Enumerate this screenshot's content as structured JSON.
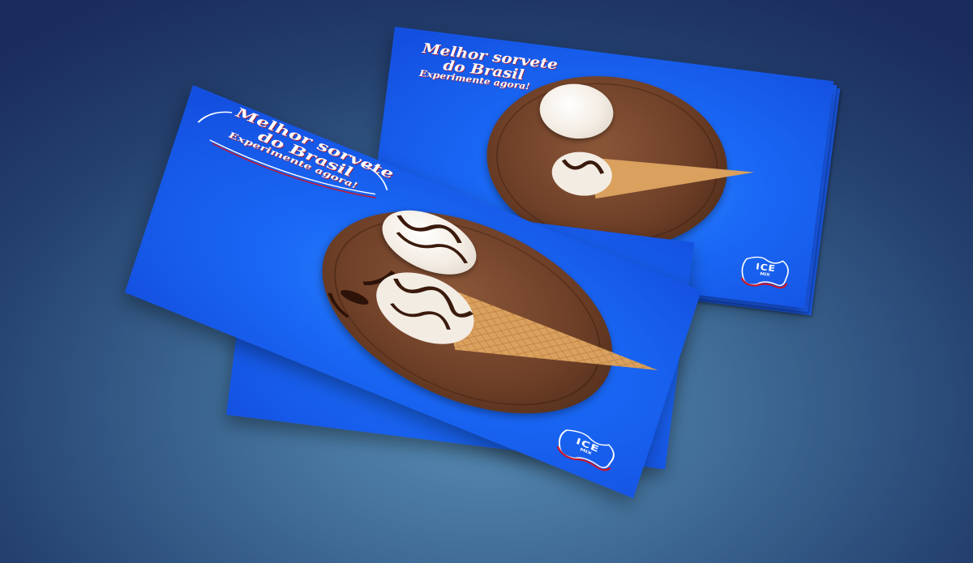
{
  "slogan": {
    "line1": "Melhor sorvete",
    "line2": "do Brasil",
    "line3": "Experimente agora!"
  },
  "logo": {
    "name": "ICE",
    "sub": "MIX"
  },
  "colors": {
    "card_blue": "#1a68f5",
    "accent_red": "#b0182a",
    "board_brown": "#6e3f27",
    "cone_tan": "#d9a05e"
  }
}
